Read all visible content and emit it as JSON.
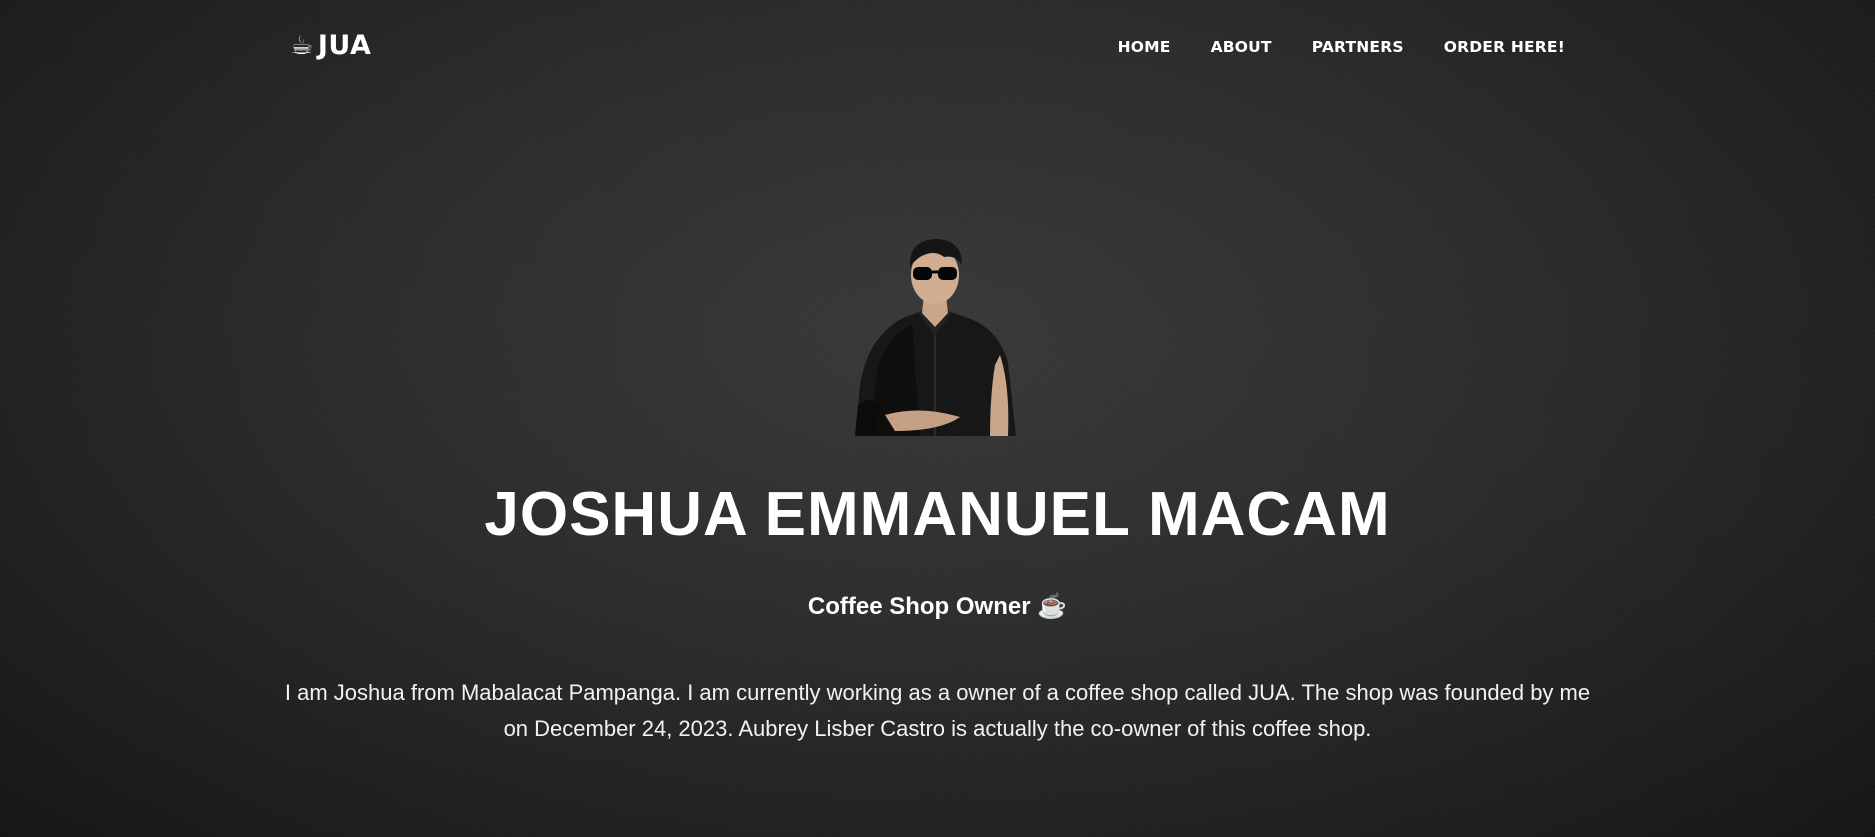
{
  "brand": {
    "icon": "coffee-cup-icon",
    "text": "JUA"
  },
  "nav": {
    "items": [
      {
        "label": "HOME"
      },
      {
        "label": "ABOUT"
      },
      {
        "label": "PARTNERS"
      },
      {
        "label": "ORDER HERE!"
      }
    ]
  },
  "profile": {
    "photo_alt": "Photo of Joshua Emmanuel Macam",
    "name": "JOSHUA EMMANUEL MACAM",
    "role": "Coffee Shop Owner",
    "role_icon": "coffee-cup-icon",
    "bio": "I am Joshua from Mabalacat Pampanga. I am currently working as a owner of a coffee shop called JUA. The shop was founded by me on December 24, 2023. Aubrey Lisber Castro is actually the co-owner of this coffee shop."
  },
  "colors": {
    "background": "#2c2c2c",
    "text": "#ffffff"
  }
}
